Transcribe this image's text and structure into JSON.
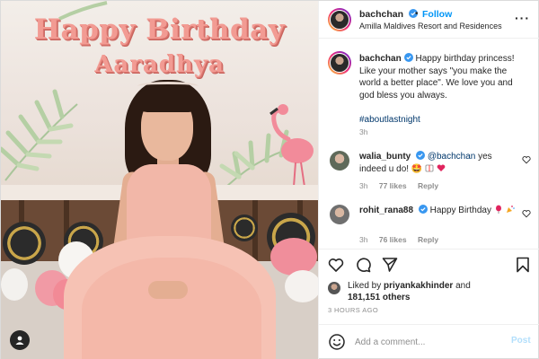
{
  "photo": {
    "banner_line1": "Happy Birthday",
    "banner_line2": "Aaradhya"
  },
  "header": {
    "username": "bachchan",
    "separator": "•",
    "follow_label": "Follow",
    "location": "Amilla Maldives Resort and Residences",
    "more_icon": "more-horizontal-icon"
  },
  "caption": {
    "username": "bachchan",
    "text": "Happy birthday princess! Like your mother says \"you make the world a better place\". We love you and god bless you always.",
    "hashtag": "#aboutlastnight",
    "time": "3h"
  },
  "comments": [
    {
      "username": "walia_bunty",
      "mention": "@bachchan",
      "text": "yes indeed u do! 🤩",
      "time": "3h",
      "likes": "77 likes",
      "reply": "Reply"
    },
    {
      "username": "rohit_rana88",
      "text": "Happy Birthday",
      "time": "3h",
      "likes": "76 likes",
      "reply": "Reply"
    }
  ],
  "liked_by": {
    "prefix": "Liked by",
    "user": "priyankakhinder",
    "conj": "and",
    "count": "181,151 others"
  },
  "posted_ago": "3 HOURS AGO",
  "add_comment": {
    "placeholder": "Add a comment...",
    "post_label": "Post"
  },
  "colors": {
    "link_blue": "#0095f6",
    "verified_blue": "#3897f0",
    "post_disabled": "#b2dffc",
    "hashtag": "#00376b",
    "muted": "#8e8e8e"
  }
}
